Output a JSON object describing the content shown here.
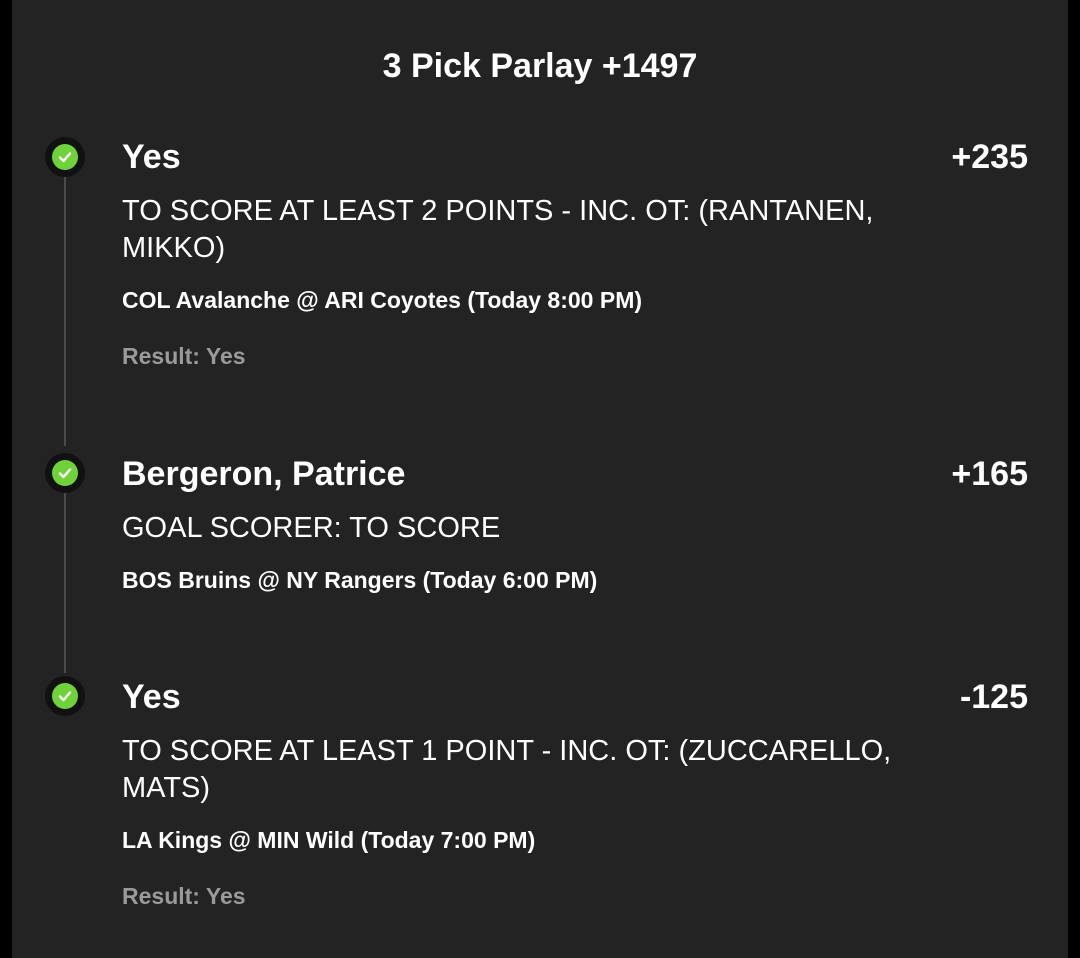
{
  "parlay": {
    "title": "3 Pick Parlay +1497"
  },
  "legs": [
    {
      "selection": "Yes",
      "odds": "+235",
      "market": "TO SCORE AT LEAST 2 POINTS - INC. OT: (RANTANEN, MIKKO)",
      "event": "COL Avalanche @ ARI Coyotes (Today 8:00 PM)",
      "result": "Result: Yes"
    },
    {
      "selection": "Bergeron, Patrice",
      "odds": "+165",
      "market": "GOAL SCORER: TO SCORE",
      "event": "BOS Bruins @ NY Rangers (Today 6:00 PM)"
    },
    {
      "selection": "Yes",
      "odds": "-125",
      "market": "TO SCORE AT LEAST 1 POINT - INC. OT: (ZUCCARELLO, MATS)",
      "event": "LA Kings @ MIN Wild (Today 7:00 PM)",
      "result": "Result: Yes"
    }
  ],
  "colors": {
    "background": "#232323",
    "win_check": "#6fd23a",
    "result_text": "#9a9a9a",
    "timeline": "#4a4a4a"
  },
  "icons": {
    "leg_status": "check-circle-icon"
  }
}
